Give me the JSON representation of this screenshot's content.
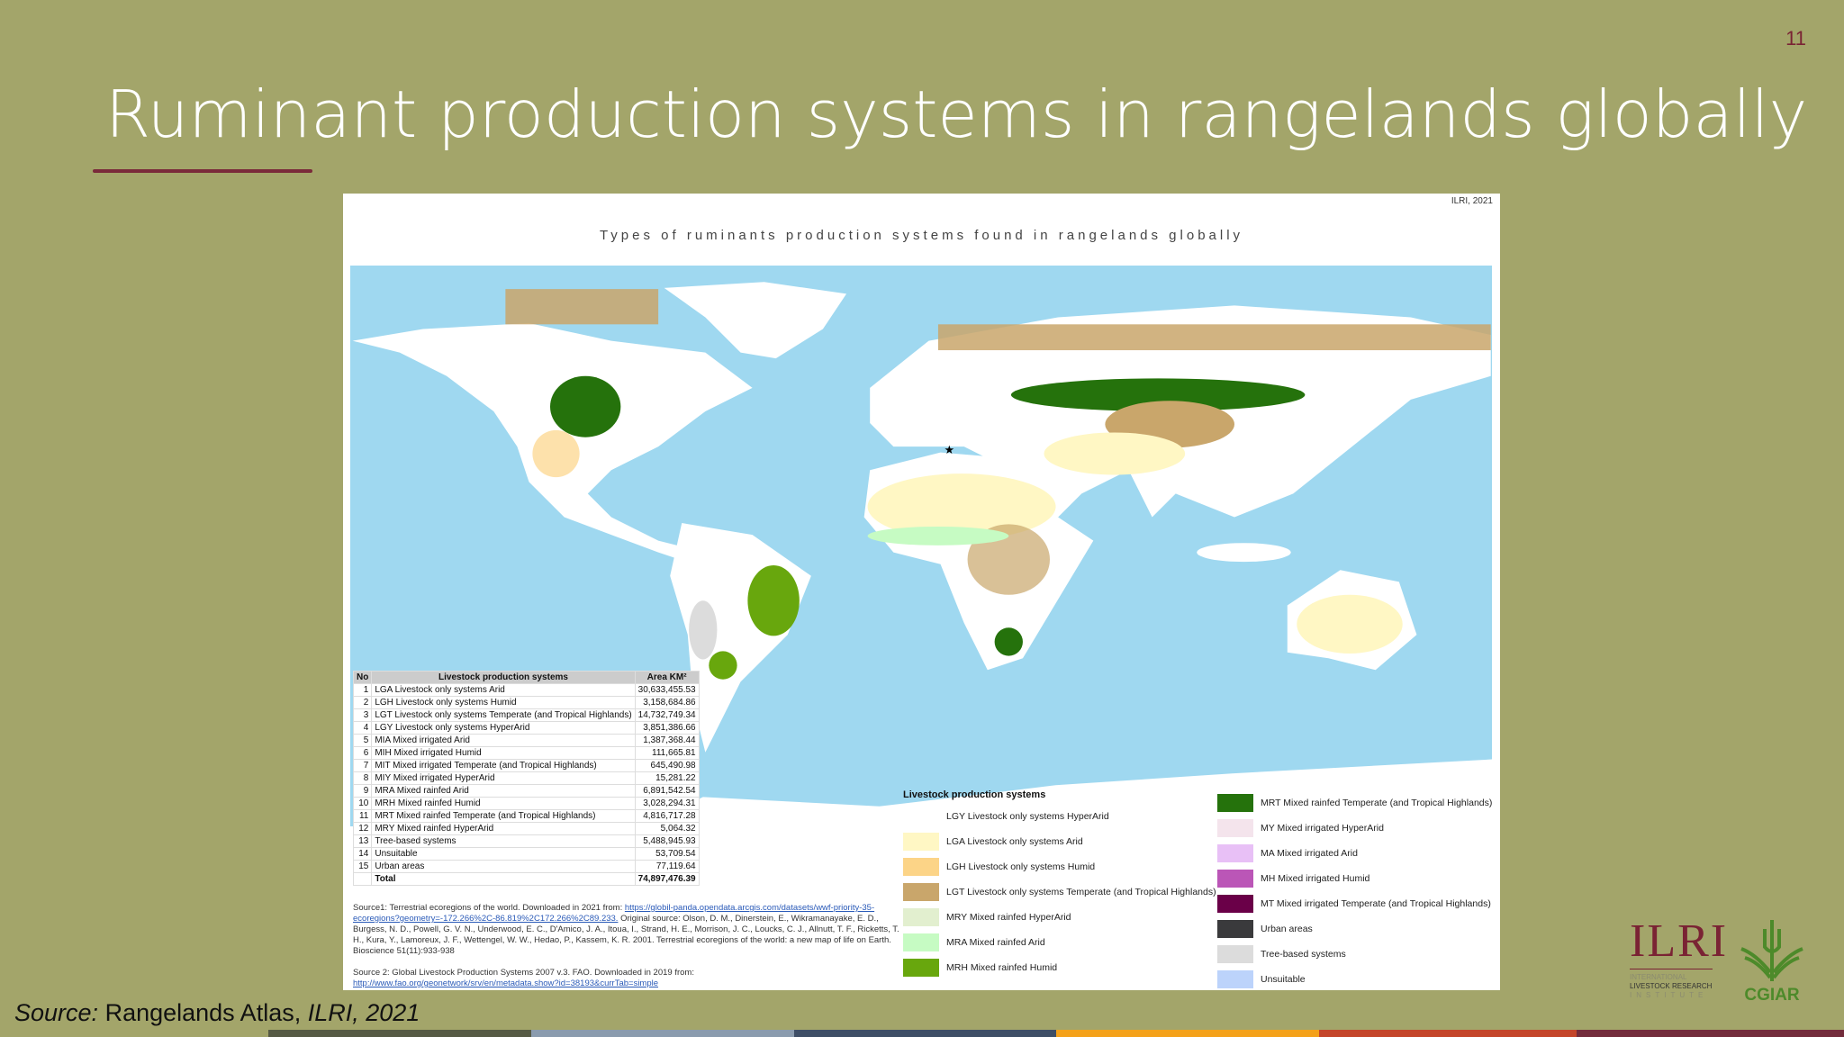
{
  "slide": {
    "page_number": "11",
    "title": "Ruminant production systems in rangelands globally",
    "caption": {
      "prefix": "Source:",
      "text": " Rangelands Atlas, ",
      "org": "ILRI, 2021"
    }
  },
  "map": {
    "credit": "ILRI, 2021",
    "title": "Types of ruminants production systems found in rangelands globally"
  },
  "table": {
    "headers": [
      "No",
      "Livestock production systems",
      "Area KM²"
    ],
    "rows": [
      {
        "no": "1",
        "name": "LGA Livestock only systems Arid",
        "area": "30,633,455.53"
      },
      {
        "no": "2",
        "name": "LGH Livestock only systems Humid",
        "area": "3,158,684.86"
      },
      {
        "no": "3",
        "name": "LGT Livestock only systems Temperate (and Tropical Highlands)",
        "area": "14,732,749.34"
      },
      {
        "no": "4",
        "name": "LGY Livestock only systems HyperArid",
        "area": "3,851,386.66"
      },
      {
        "no": "5",
        "name": "MIA Mixed irrigated Arid",
        "area": "1,387,368.44"
      },
      {
        "no": "6",
        "name": "MIH Mixed irrigated Humid",
        "area": "111,665.81"
      },
      {
        "no": "7",
        "name": "MIT Mixed irrigated Temperate (and Tropical Highlands)",
        "area": "645,490.98"
      },
      {
        "no": "8",
        "name": "MIY Mixed irrigated HyperArid",
        "area": "15,281.22"
      },
      {
        "no": "9",
        "name": "MRA Mixed rainfed Arid",
        "area": "6,891,542.54"
      },
      {
        "no": "10",
        "name": "MRH Mixed rainfed Humid",
        "area": "3,028,294.31"
      },
      {
        "no": "11",
        "name": "MRT Mixed rainfed Temperate (and Tropical Highlands)",
        "area": "4,816,717.28"
      },
      {
        "no": "12",
        "name": "MRY Mixed rainfed HyperArid",
        "area": "5,064.32"
      },
      {
        "no": "13",
        "name": "Tree-based systems",
        "area": "5,488,945.93"
      },
      {
        "no": "14",
        "name": "Unsuitable",
        "area": "53,709.54"
      },
      {
        "no": "15",
        "name": "Urban areas",
        "area": "77,119.64"
      }
    ],
    "total_label": "Total",
    "total": "74,897,476.39"
  },
  "sources": {
    "s1_text": "Source1: Terrestrial ecoregions of the world. Downloaded in  2021 from: ",
    "s1_link": "https://globil-panda.opendata.arcgis.com/datasets/wwf-priority-35-ecoregions?geometry=-172.266%2C-86.819%2C172.266%2C89.233.",
    "s1_rest": " Original source: Olson, D. M., Dinerstein, E., Wikramanayake, E. D., Burgess, N. D., Powell, G. V. N., Underwood, E. C., D'Amico, J. A., Itoua, I., Strand, H. E., Morrison, J. C., Loucks, C. J., Allnutt, T. F., Ricketts, T. H., Kura, Y., Lamoreux, J. F., Wettengel, W. W., Hedao, P., Kassem, K. R. 2001. Terrestrial ecoregions of the world: a new map of life on Earth. Bioscience 51(11):933-938",
    "s2_text": "Source 2: Global Livestock Production Systems 2007 v.3. FAO. Downloaded in 2019 from:",
    "s2_link": "http://www.fao.org/geonetwork/srv/en/metadata.show?id=38193&currTab=simple"
  },
  "legend": {
    "title": "Livestock production systems",
    "left": [
      {
        "label": "LGY Livestock only systems HyperArid",
        "color": "#ffffff"
      },
      {
        "label": "LGA Livestock only systems Arid",
        "color": "#fff7c4"
      },
      {
        "label": "LGH Livestock only systems Humid",
        "color": "#fcd487"
      },
      {
        "label": "LGT Livestock only systems Temperate (and Tropical Highlands)",
        "color": "#c9a66b"
      },
      {
        "label": "MRY Mixed rainfed HyperArid",
        "color": "#e2efcf"
      },
      {
        "label": "MRA Mixed rainfed Arid",
        "color": "#c6fbc3"
      },
      {
        "label": "MRH Mixed rainfed Humid",
        "color": "#68a70d"
      }
    ],
    "right": [
      {
        "label": "MRT Mixed rainfed Temperate (and Tropical Highlands)",
        "color": "#25720c"
      },
      {
        "label": "MY Mixed irrigated HyperArid",
        "color": "#f4e4ec"
      },
      {
        "label": "MA Mixed irrigated Arid",
        "color": "#e8c0f6"
      },
      {
        "label": "MH Mixed irrigated Humid",
        "color": "#bb56b7"
      },
      {
        "label": "MT Mixed irrigated Temperate (and Tropical Highlands)",
        "color": "#6a0048"
      },
      {
        "label": "Urban areas",
        "color": "#3a3a3c"
      },
      {
        "label": "Tree-based systems",
        "color": "#dcdcdc"
      },
      {
        "label": "Unsuitable",
        "color": "#bcd3fb"
      }
    ]
  },
  "logos": {
    "ilri": "ILRI",
    "ilri_l1": "INTERNATIONAL",
    "ilri_l2": "LIVESTOCK RESEARCH",
    "ilri_l3": "INSTITUTE",
    "cgiar": "CGIAR"
  },
  "colors": {
    "background": "#a3a56a",
    "ocean": "#9fd8f0",
    "accent": "#7a2334",
    "bottom_bar": [
      "#565a44",
      "#8a9bae",
      "#3e4e66",
      "#f4a11a",
      "#c4452a",
      "#732c3c"
    ]
  }
}
